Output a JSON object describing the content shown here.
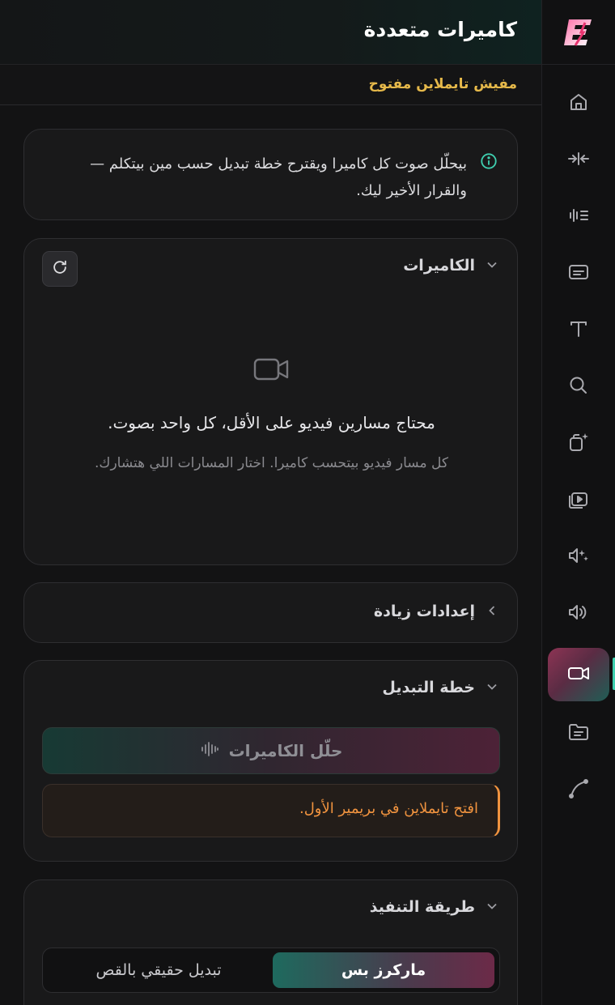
{
  "header": {
    "title": "كاميرات متعددة"
  },
  "status": {
    "text": "مفيش تايملاين مفتوح"
  },
  "info": {
    "icon": "info-circle-icon",
    "text": "بيحلّل صوت كل كاميرا ويقترح خطة تبديل حسب مين بيتكلم — والقرار الأخير ليك."
  },
  "cameras": {
    "title": "الكاميرات",
    "refresh_icon": "refresh-icon",
    "empty_icon": "video-camera-icon",
    "empty_title": "محتاج مسارين فيديو على الأقل، كل واحد بصوت.",
    "empty_subtitle": "كل مسار فيديو بيتحسب كاميرا. اختار المسارات اللي هتشارك."
  },
  "more_settings": {
    "title": "إعدادات زيادة"
  },
  "switch_plan": {
    "title": "خطة التبديل",
    "analyze_label": "حلّل الكاميرات",
    "warning": "افتح تايملاين في بريمير الأول."
  },
  "execution": {
    "title": "طريقة التنفيذ",
    "options": [
      "ماركرز بس",
      "تبديل حقيقي بالقص"
    ],
    "selected": "ماركرز بس"
  },
  "rail": {
    "logo": "E",
    "items": [
      "home-icon",
      "compress-icon",
      "waveform-icon",
      "captions-icon",
      "text-icon",
      "search-icon",
      "ai-crop-icon",
      "video-player-icon",
      "ai-audio-icon",
      "speaker-icon",
      "multicam-icon",
      "folder-icon",
      "curve-icon"
    ],
    "active": "multicam-icon"
  },
  "colors": {
    "accent_teal": "#3fd0b0",
    "accent_pink": "#8d3454",
    "warning": "#f0933f",
    "status_yellow": "#e6b94a"
  }
}
